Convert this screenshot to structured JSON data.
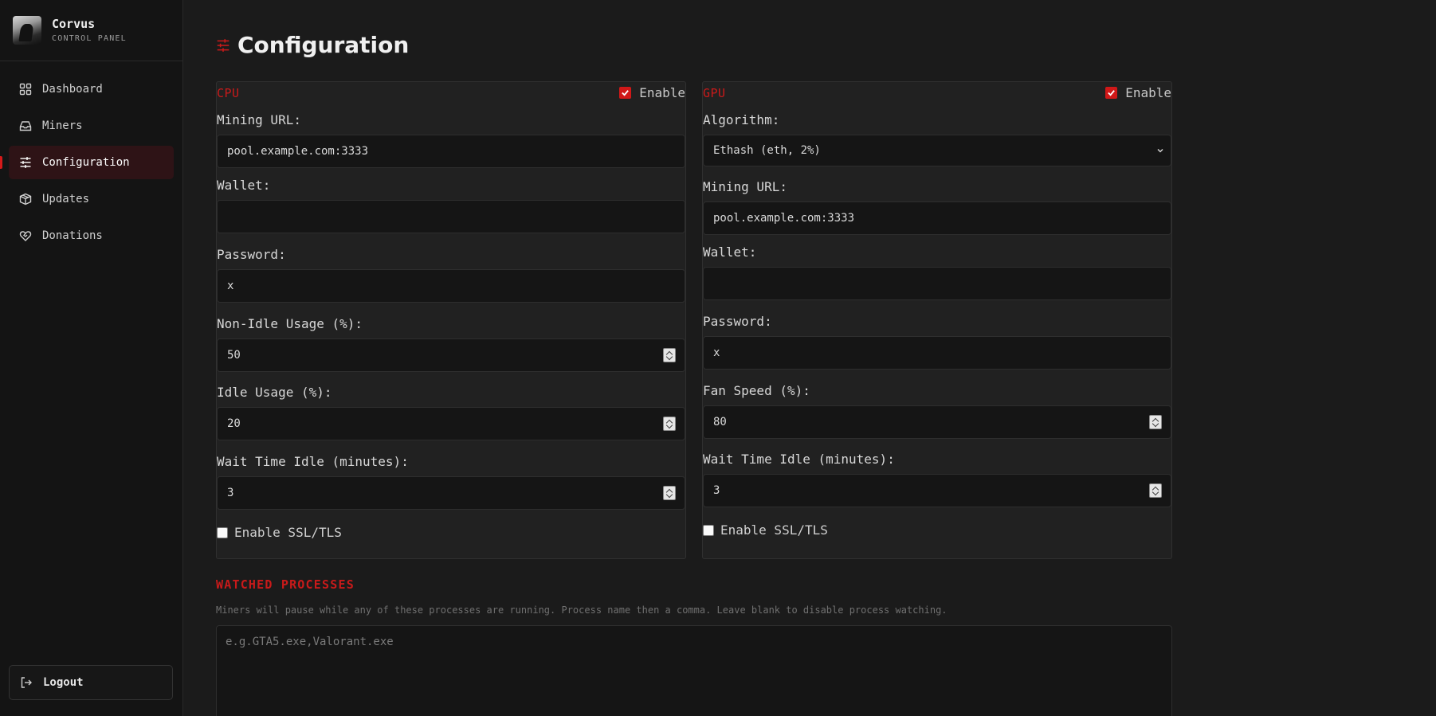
{
  "brand": {
    "name": "Corvus",
    "subtitle": "CONTROL PANEL"
  },
  "nav": {
    "items": [
      {
        "label": "Dashboard",
        "icon": "grid-icon"
      },
      {
        "label": "Miners",
        "icon": "drawer-icon"
      },
      {
        "label": "Configuration",
        "icon": "sliders-icon",
        "active": true
      },
      {
        "label": "Updates",
        "icon": "package-icon"
      },
      {
        "label": "Donations",
        "icon": "heart-hand-icon"
      }
    ],
    "logout": "Logout"
  },
  "page": {
    "title": "Configuration"
  },
  "cpu": {
    "title": "CPU",
    "enable_label": "Enable",
    "enabled": true,
    "mining_url_label": "Mining URL:",
    "mining_url": "pool.example.com:3333",
    "wallet_label": "Wallet:",
    "wallet": "",
    "password_label": "Password:",
    "password": "x",
    "non_idle_label": "Non-Idle Usage (%):",
    "non_idle": "50",
    "idle_label": "Idle Usage (%):",
    "idle": "20",
    "wait_label": "Wait Time Idle (minutes):",
    "wait": "3",
    "ssl_label": "Enable SSL/TLS",
    "ssl": false
  },
  "gpu": {
    "title": "GPU",
    "enable_label": "Enable",
    "enabled": true,
    "algorithm_label": "Algorithm:",
    "algorithm": "Ethash (eth, 2%)",
    "mining_url_label": "Mining URL:",
    "mining_url": "pool.example.com:3333",
    "wallet_label": "Wallet:",
    "wallet": "",
    "password_label": "Password:",
    "password": "x",
    "fan_label": "Fan Speed (%):",
    "fan": "80",
    "wait_label": "Wait Time Idle (minutes):",
    "wait": "3",
    "ssl_label": "Enable SSL/TLS",
    "ssl": false
  },
  "watched": {
    "title": "WATCHED PROCESSES",
    "description": "Miners will pause while any of these processes are running. Process name then a comma. Leave blank to disable process watching.",
    "placeholder": "e.g.GTA5.exe,Valorant.exe"
  },
  "colors": {
    "accent": "#c91a1a",
    "background": "#1b1b1b",
    "card": "#212121"
  }
}
